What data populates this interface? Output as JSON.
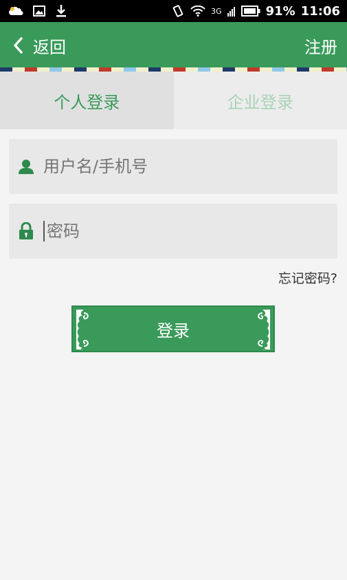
{
  "status_bar": {
    "battery": "91%",
    "time": "11:06",
    "network": "3G"
  },
  "header": {
    "back_label": "返回",
    "register_label": "注册"
  },
  "tabs": [
    {
      "label": "个人登录",
      "active": true
    },
    {
      "label": "企业登录",
      "active": false
    }
  ],
  "form": {
    "username_placeholder": "用户名/手机号",
    "password_placeholder": "密码",
    "forgot_label": "忘记密码?",
    "login_label": "登录"
  },
  "colors": {
    "primary": "#3a9a5a",
    "inactive_tab_text": "#a9d3b6"
  }
}
